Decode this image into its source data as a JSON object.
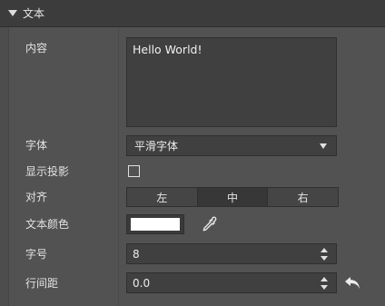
{
  "section": {
    "title": "文本"
  },
  "rows": {
    "content": {
      "label": "内容",
      "value": "Hello World!"
    },
    "font": {
      "label": "字体",
      "value": "平滑字体"
    },
    "shadow": {
      "label": "显示投影",
      "checked": false
    },
    "align": {
      "label": "对齐",
      "options": [
        "左",
        "中",
        "右"
      ],
      "selected": "中"
    },
    "text_color": {
      "label": "文本颜色",
      "color": "#ffffff",
      "icon": "eyedropper-icon"
    },
    "font_size": {
      "label": "字号",
      "value": "8"
    },
    "line_spacing": {
      "label": "行间距",
      "value": "0.0",
      "reset_icon": "undo-icon"
    }
  }
}
